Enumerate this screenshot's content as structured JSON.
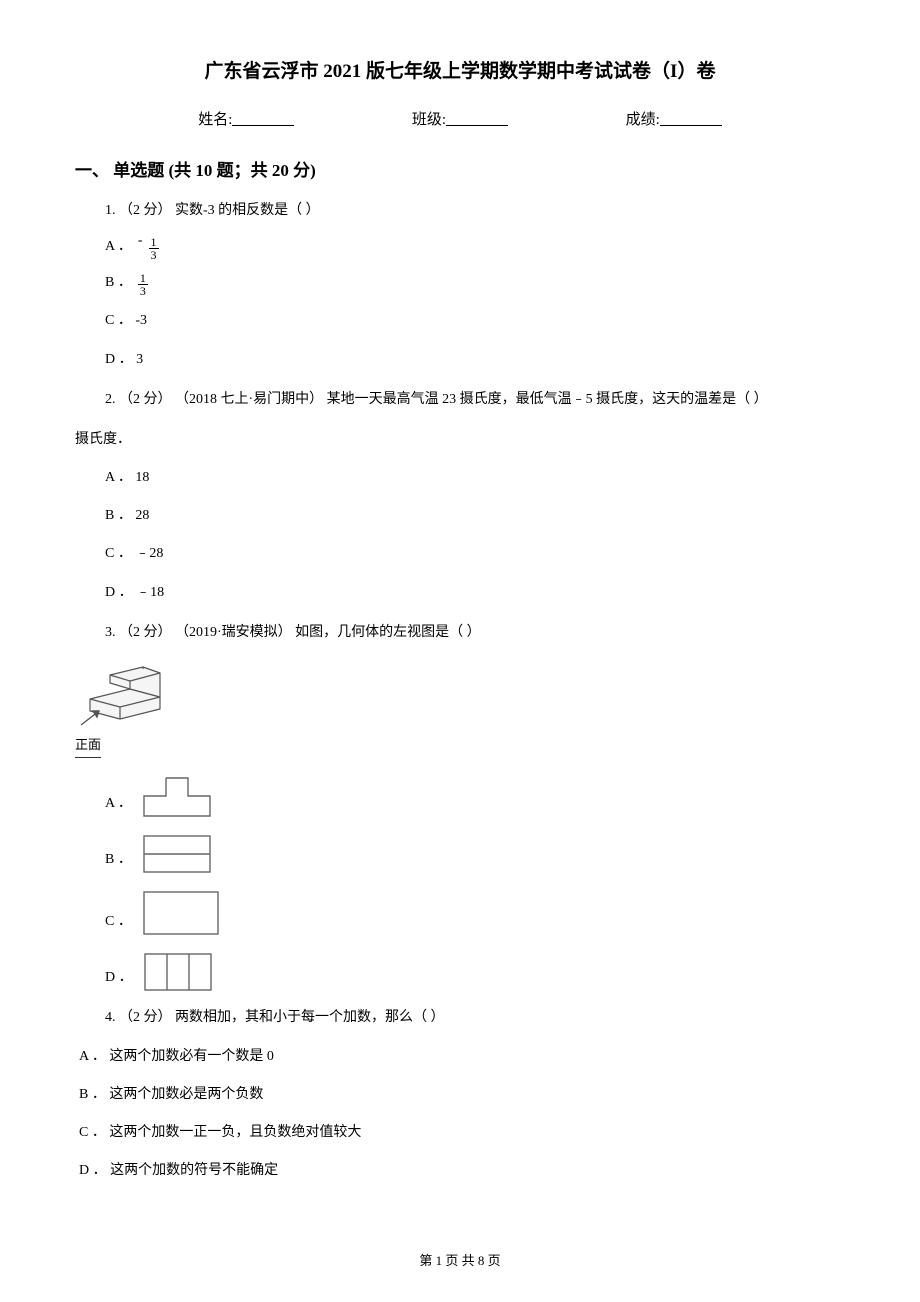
{
  "title": "广东省云浮市 2021 版七年级上学期数学期中考试试卷（I）卷",
  "info": {
    "name_label": "姓名:",
    "class_label": "班级:",
    "score_label": "成绩:"
  },
  "section1": {
    "heading": "一、 单选题 (共 10 题；共 20 分)"
  },
  "q1": {
    "stem": "1.  （2 分） 实数-3 的相反数是（    ）",
    "a_label": "A ．",
    "a_neg": "-",
    "a_num": "1",
    "a_den": "3",
    "b_label": "B ．",
    "b_num": "1",
    "b_den": "3",
    "c": "C ． -3",
    "d": "D ． 3"
  },
  "q2": {
    "stem_line1": "2.  （2 分） （2018 七上·易门期中） 某地一天最高气温 23 摄氏度，最低气温﹣5 摄氏度，这天的温差是（    ）",
    "stem_line2": "摄氏度．",
    "a": "A ． 18",
    "b": "B ． 28",
    "c": "C ． ﹣28",
    "d": "D ． ﹣18"
  },
  "q3": {
    "stem": "3.  （2 分） （2019·瑞安模拟） 如图，几何体的左视图是（    ）",
    "front_label": "正面",
    "a_label": "A ．",
    "b_label": "B ．",
    "c_label": "C ．",
    "d_label": "D ．"
  },
  "q4": {
    "stem": "4.  （2 分） 两数相加，其和小于每一个加数，那么（    ）",
    "a": "A ． 这两个加数必有一个数是 0",
    "b": "B ． 这两个加数必是两个负数",
    "c": "C ． 这两个加数一正一负，且负数绝对值较大",
    "d": "D ． 这两个加数的符号不能确定"
  },
  "footer": {
    "text": "第 1 页 共 8 页"
  }
}
